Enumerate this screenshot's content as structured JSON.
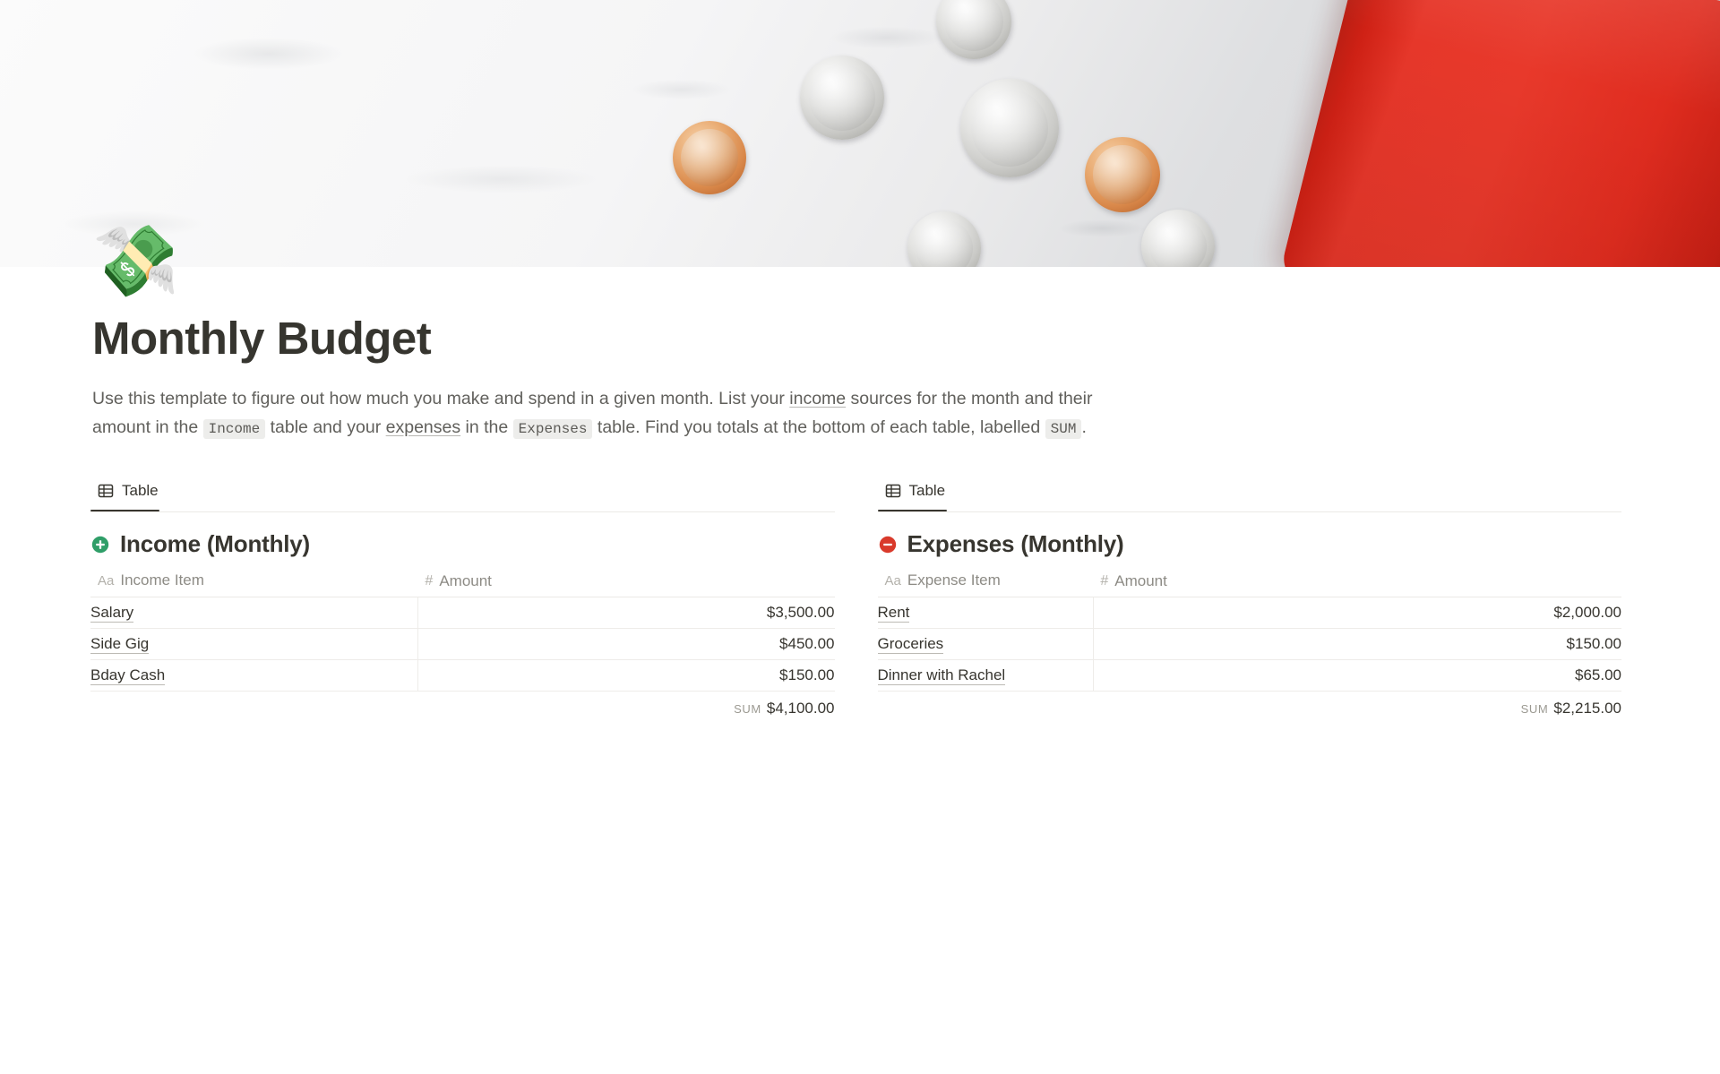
{
  "cover": {
    "alt": "coins on white marble with red leather notebook"
  },
  "page": {
    "icon": "💸",
    "icon_name": "money-with-wings-emoji",
    "title": "Monthly Budget",
    "description": {
      "part1": "Use this template to figure out how much you make and spend in a given month. List your ",
      "link1": "income",
      "part2": " sources for the month and their amount in the ",
      "chip1": "Income",
      "part3": " table and your ",
      "link2": "expenses",
      "part4": " in the ",
      "chip2": "Expenses",
      "part5": " table. Find you totals at the bottom of each table, labelled ",
      "chip3": "SUM",
      "part6": "."
    }
  },
  "income": {
    "tab_label": "Table",
    "title": "Income (Monthly)",
    "badge_color": "#2f9e68",
    "badge_name": "green-plus-circle-icon",
    "columns": {
      "name": "Income Item",
      "name_type": "Aa",
      "amount": "Amount",
      "amount_type": "#"
    },
    "rows": [
      {
        "name": "Salary",
        "amount": "$3,500.00"
      },
      {
        "name": "Side Gig",
        "amount": "$450.00"
      },
      {
        "name": "Bday Cash",
        "amount": "$150.00"
      }
    ],
    "sum_label": "SUM",
    "sum_value": "$4,100.00"
  },
  "expenses": {
    "tab_label": "Table",
    "title": "Expenses (Monthly)",
    "badge_color": "#d93a2b",
    "badge_name": "red-minus-circle-icon",
    "columns": {
      "name": "Expense Item",
      "name_type": "Aa",
      "amount": "Amount",
      "amount_type": "#"
    },
    "rows": [
      {
        "name": "Rent",
        "amount": "$2,000.00"
      },
      {
        "name": "Groceries",
        "amount": "$150.00"
      },
      {
        "name": "Dinner with Rachel",
        "amount": "$65.00"
      }
    ],
    "sum_label": "SUM",
    "sum_value": "$2,215.00"
  },
  "theme": {
    "text_primary": "#37352f",
    "text_secondary": "#61605c",
    "text_muted": "#8d8b85",
    "border": "#eceae6",
    "chip_bg": "#ededeb",
    "cover_red": "#e6372a"
  }
}
